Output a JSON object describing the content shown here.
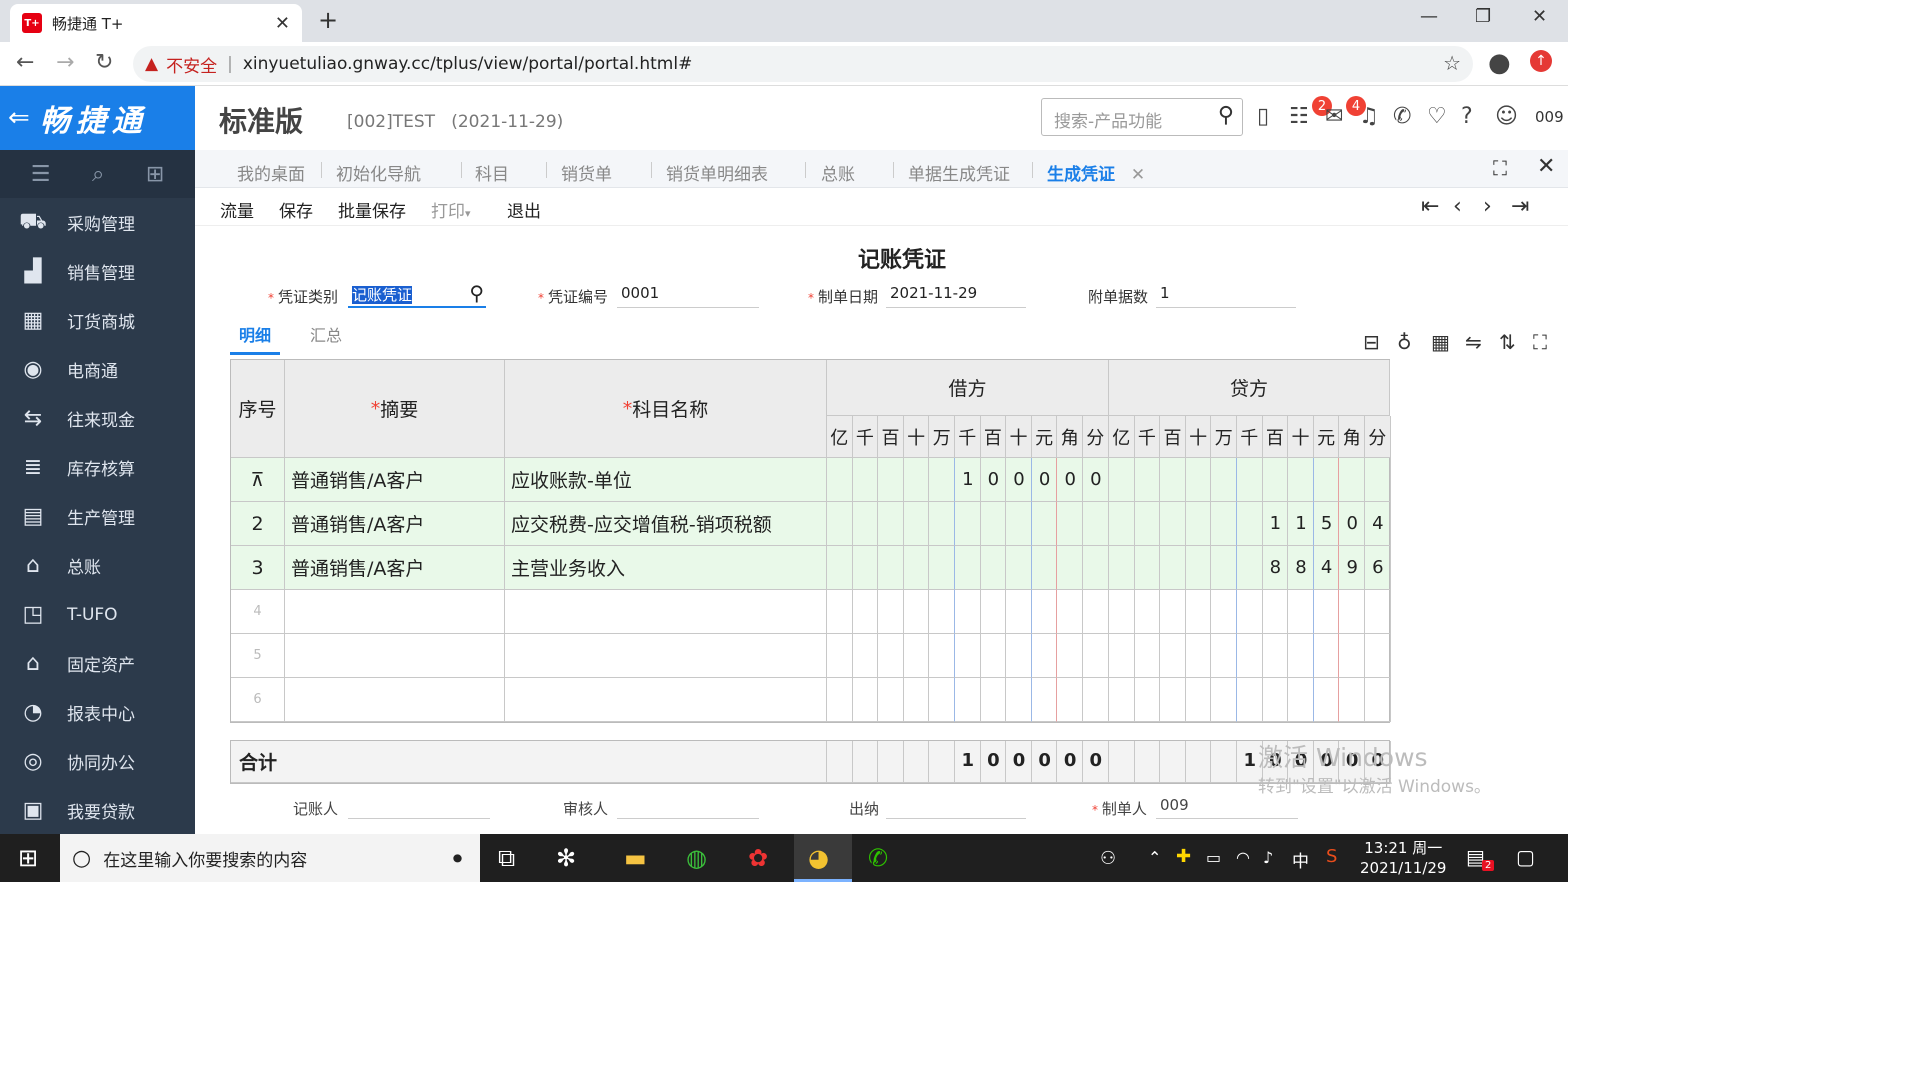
{
  "browser": {
    "tab_title": "畅捷通 T+",
    "favicon_text": "T+",
    "security_label": "不安全",
    "url": "xinyuetuliao.gnway.cc/tplus/view/portal/portal.html#"
  },
  "app": {
    "logo": "畅捷通",
    "edition": "标准版",
    "account": "[002]TEST",
    "date": "(2021-11-29)",
    "search_placeholder": "搜索-产品功能",
    "badge_msg": "2",
    "badge_todo": "4",
    "user": "009"
  },
  "sidebar": {
    "items": [
      {
        "label": "采购管理",
        "icon": "cart-icon"
      },
      {
        "label": "销售管理",
        "icon": "chart-icon"
      },
      {
        "label": "订货商城",
        "icon": "store-icon"
      },
      {
        "label": "电商通",
        "icon": "ecommerce-icon"
      },
      {
        "label": "往来现金",
        "icon": "cash-icon"
      },
      {
        "label": "库存核算",
        "icon": "inventory-icon"
      },
      {
        "label": "生产管理",
        "icon": "production-icon"
      },
      {
        "label": "总账",
        "icon": "ledger-icon"
      },
      {
        "label": "T-UFO",
        "icon": "ufo-icon"
      },
      {
        "label": "固定资产",
        "icon": "bank-icon"
      },
      {
        "label": "报表中心",
        "icon": "report-icon"
      },
      {
        "label": "协同办公",
        "icon": "office-icon"
      },
      {
        "label": "我要贷款",
        "icon": "loan-icon"
      }
    ]
  },
  "tabs": [
    "我的桌面",
    "初始化导航",
    "科目",
    "销货单",
    "销货单明细表",
    "总账",
    "单据生成凭证",
    "生成凭证"
  ],
  "toolbar": {
    "flow": "流量",
    "save": "保存",
    "batch_save": "批量保存",
    "print": "打印",
    "exit": "退出"
  },
  "voucher": {
    "title": "记账凭证",
    "type_label": "凭证类别",
    "type_value": "记账凭证",
    "no_label": "凭证编号",
    "no_value": "0001",
    "date_label": "制单日期",
    "date_value": "2021-11-29",
    "attach_label": "附单据数",
    "attach_value": "1",
    "subtab_detail": "明细",
    "subtab_summary": "汇总"
  },
  "grid": {
    "col_seq": "序号",
    "col_summary": "摘要",
    "col_account": "科目名称",
    "col_debit": "借方",
    "col_credit": "贷方",
    "units": [
      "亿",
      "千",
      "百",
      "十",
      "万",
      "千",
      "百",
      "十",
      "元",
      "角",
      "分"
    ],
    "rows": [
      {
        "seq": "",
        "summary": "普通销售/A客户",
        "account": "应收账款-单位",
        "debit": "100000",
        "credit": ""
      },
      {
        "seq": "2",
        "summary": "普通销售/A客户",
        "account": "应交税费-应交增值税-销项税额",
        "debit": "",
        "credit": "11504"
      },
      {
        "seq": "3",
        "summary": "普通销售/A客户",
        "account": "主营业务收入",
        "debit": "",
        "credit": "88496"
      },
      {
        "seq": "4",
        "summary": "",
        "account": "",
        "debit": "",
        "credit": ""
      },
      {
        "seq": "5",
        "summary": "",
        "account": "",
        "debit": "",
        "credit": ""
      },
      {
        "seq": "6",
        "summary": "",
        "account": "",
        "debit": "",
        "credit": ""
      }
    ],
    "total_label": "合计",
    "total_debit": "100000",
    "total_credit": "100000"
  },
  "signatures": {
    "bookkeeper": "记账人",
    "auditor": "审核人",
    "cashier": "出纳",
    "maker": "制单人",
    "maker_value": "009"
  },
  "watermark": {
    "line1": "激活 Windows",
    "line2": "转到\"设置\"以激活 Windows。"
  },
  "taskbar": {
    "search": "在这里输入你要搜索的内容",
    "ime": "中",
    "time": "13:21 周一",
    "date": "2021/11/29",
    "notif": "2"
  }
}
